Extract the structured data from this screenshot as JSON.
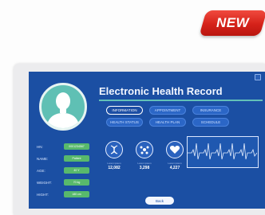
{
  "badge": {
    "label": "NEW"
  },
  "record": {
    "title": "Electronic Health Record",
    "tabs": [
      {
        "label": "INFORMATION",
        "active": true
      },
      {
        "label": "APPOINTMENT",
        "active": false
      },
      {
        "label": "INSURANCE",
        "active": false
      },
      {
        "label": "HEALTH STATUS",
        "active": false
      },
      {
        "label": "HEALTH PLAN",
        "active": false
      },
      {
        "label": "SCHEDULE",
        "active": false
      }
    ],
    "fields": [
      {
        "label": "HN:",
        "value": "0001234567"
      },
      {
        "label": "NAME:",
        "value": "Patient"
      },
      {
        "label": "AGE:",
        "value": "40 Y"
      },
      {
        "label": "WEIGHT:",
        "value": "70 kg"
      },
      {
        "label": "HIGHT:",
        "value": "180 cm"
      }
    ],
    "metrics": [
      {
        "icon": "dna-icon",
        "label": "Lorem ipsum",
        "value": "12,082"
      },
      {
        "icon": "cells-icon",
        "label": "Lorem ipsum",
        "value": "3,298"
      },
      {
        "icon": "heart-icon",
        "label": "Lorem ipsum",
        "value": "4,227"
      }
    ],
    "back_label": "Back"
  },
  "colors": {
    "screen": "#1b4fa3",
    "accent": "#62c1b8",
    "field": "#58b96c",
    "badge": "#d5221a"
  }
}
